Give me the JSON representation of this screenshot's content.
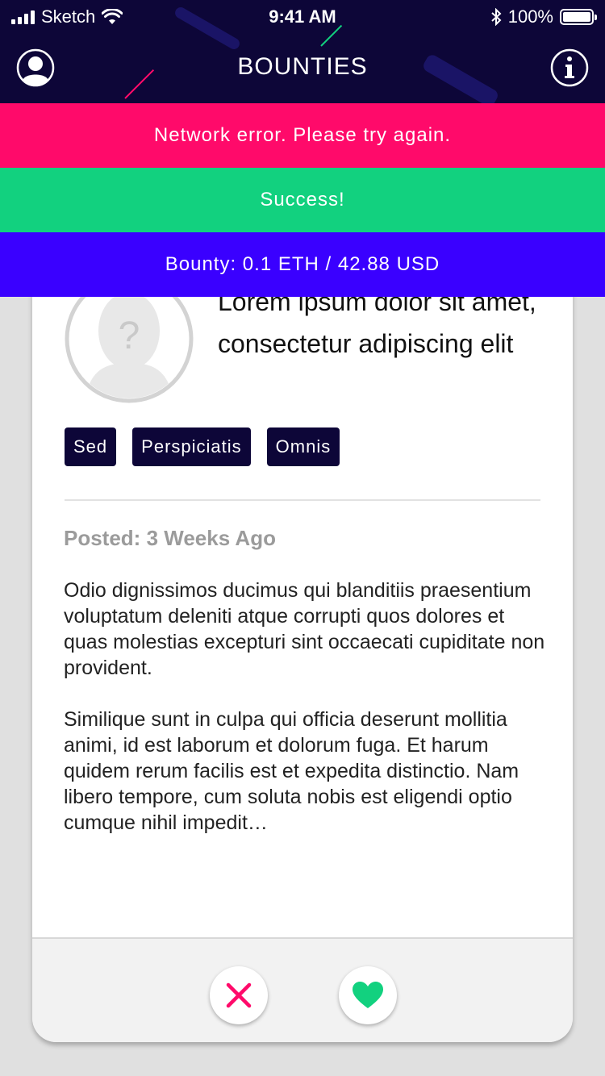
{
  "status_bar": {
    "carrier": "Sketch",
    "time": "9:41 AM",
    "battery_percent": "100%",
    "battery_level": 1.0
  },
  "nav": {
    "title": "BOUNTIES",
    "profile_icon": "user-icon",
    "info_icon": "info-icon"
  },
  "banners": {
    "error": "Network error. Please try again.",
    "success": "Success!",
    "bounty": "Bounty: 0.1 ETH / 42.88 USD"
  },
  "card": {
    "title": "Lorem ipsum dolor sit amet, consectetur adipiscing elit",
    "tags": [
      "Sed",
      "Perspiciatis",
      "Omnis"
    ],
    "posted": "Posted: 3 Weeks Ago",
    "paragraphs": [
      "Odio dignissimos ducimus qui blanditiis praesentium voluptatum deleniti atque corrupti quos dolores et quas molestias excepturi sint occaecati cupiditate non provident.",
      "Similique sunt in culpa qui officia deserunt mollitia animi, id est laborum et dolorum fuga. Et harum quidem rerum facilis est et expedita distinctio. Nam libero tempore, cum soluta nobis est eligendi optio cumque nihil impedit…"
    ]
  },
  "actions": {
    "reject_icon": "close-icon",
    "like_icon": "heart-icon"
  },
  "colors": {
    "header": "#0d0638",
    "error": "#ff0a6a",
    "success": "#12d17f",
    "bounty": "#3a00ff",
    "tag": "#0d0638",
    "reject": "#ff0a6a",
    "like": "#12d17f"
  }
}
